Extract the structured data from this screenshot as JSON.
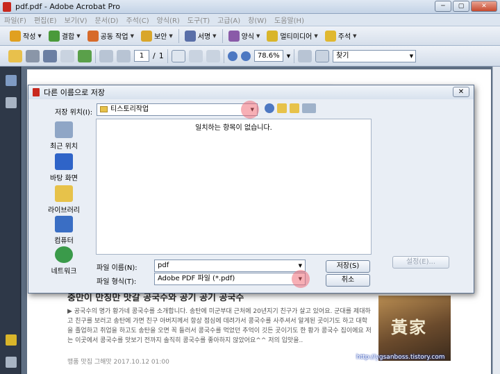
{
  "window": {
    "title": "pdf.pdf - Adobe Acrobat Pro",
    "min_glyph": "─",
    "max_glyph": "▢",
    "close_glyph": "✕"
  },
  "menu": [
    "파일(F)",
    "편집(E)",
    "보기(V)",
    "문서(D)",
    "주석(C)",
    "양식(R)",
    "도구(T)",
    "고급(A)",
    "창(W)",
    "도움말(H)"
  ],
  "task_toolbar": [
    {
      "label": "작성",
      "icon": "create-pdf-icon",
      "color": "#e0a020"
    },
    {
      "label": "결합",
      "icon": "combine-icon",
      "color": "#4a9a3a"
    },
    {
      "label": "공동 작업",
      "icon": "collaborate-icon",
      "color": "#d76a2a"
    },
    {
      "label": "보안",
      "icon": "lock-icon",
      "color": "#d9a62a"
    },
    {
      "label": "서명",
      "icon": "pen-icon",
      "color": "#5a6fa8"
    },
    {
      "label": "양식",
      "icon": "form-icon",
      "color": "#8a5aa8"
    },
    {
      "label": "멀티미디어",
      "icon": "multimedia-icon",
      "color": "#d9b52a"
    },
    {
      "label": "주석",
      "icon": "comment-icon",
      "color": "#e0b830"
    }
  ],
  "nav_toolbar": {
    "page_current": "1",
    "page_sep": "/",
    "page_total": "1",
    "zoom": "78.6%",
    "search_placeholder": "찾기"
  },
  "dialog": {
    "title": "다른 이름으로 저장",
    "close_glyph": "✕",
    "save_in_label": "저장 위치(I):",
    "save_in_value": "티스토리작업",
    "empty_message": "일치하는 항목이 없습니다.",
    "places": [
      "최근 위치",
      "바탕 화면",
      "라이브러리",
      "컴퓨터",
      "네트워크"
    ],
    "filename_label": "파일 이름(N):",
    "filename_value": "pdf",
    "filetype_label": "파일 형식(T):",
    "filetype_value": "Adobe PDF 파일 (*.pdf)",
    "save_button": "저장(S)",
    "cancel_button": "취소",
    "settings_button": "설정(E)...",
    "dropdown_glyph": "▼"
  },
  "document": {
    "headline": "충만이 만칭만 맛갈 공국수와 공기 공기 공국수",
    "body": "▶ 공국수의 명가 황가네 콩국수를 소개합니다. 송탄에 미군부대 근처에 20년지기 친구가 살고 있어요. 군대를 제대하고 친구를 보러고 송탄에 가면 친구 아버지께서 항상 점심에 데려가서 콩국수를 사주셔서 알게된 곳이기도 하고 대학을 졸업하고 취업을 하고도 송탄을 오면 꼭 들러서 콩국수를 먹었던 추억이 깃든 곳이기도 한 황가 콩국수 집이에요 저는 이곳에서 콩국수를 맛보기 전까지 솔직히 콩국수를 좋아하지 않았어요^^ 저의 입맛을..",
    "meta": "맹품 맛집 그해맛    2017.10.12 01:00",
    "photo_sign": "黃家",
    "watermark_url": "http://ygsanboss.tistory.com"
  },
  "colors": {
    "dialog_bg": "#e9eef5",
    "highlight_circle": "#f06e78",
    "acrobat_red": "#c8281e"
  }
}
